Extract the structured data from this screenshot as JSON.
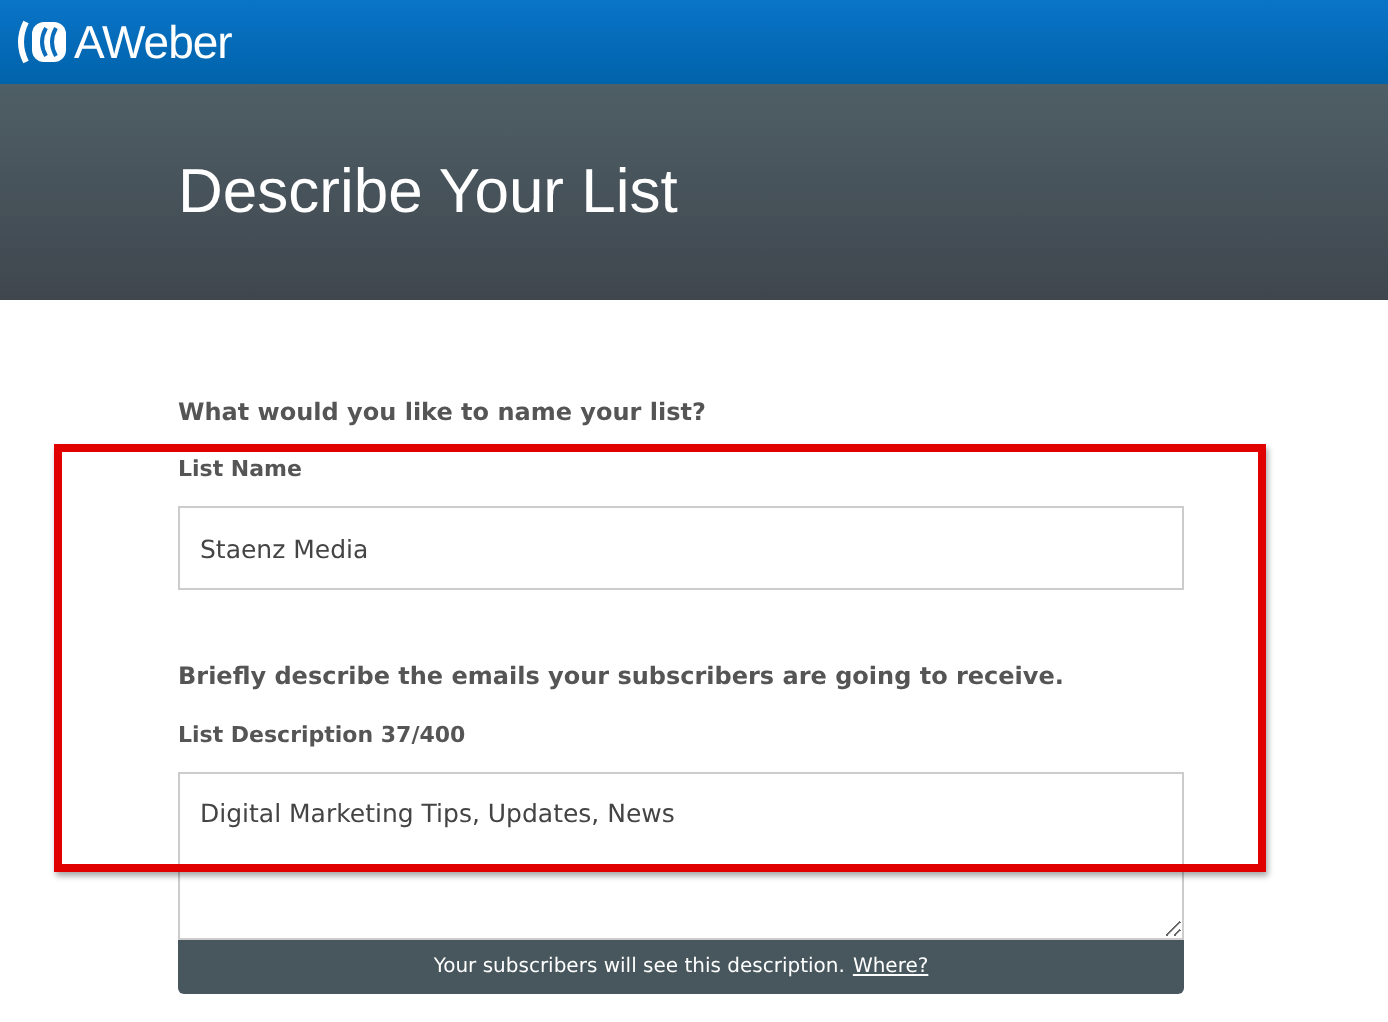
{
  "brand": {
    "name": "AWeber"
  },
  "header": {
    "title": "Describe Your List"
  },
  "form": {
    "name_question": "What would you like to name your list?",
    "name_label": "List Name",
    "name_value": "Staenz Media",
    "description_question": "Briefly describe the emails your subscribers are going to receive.",
    "description_label": "List Description 37/400",
    "description_value": "Digital Marketing Tips, Updates, News",
    "note": "Your subscribers will see this description.",
    "note_link": "Where?"
  }
}
